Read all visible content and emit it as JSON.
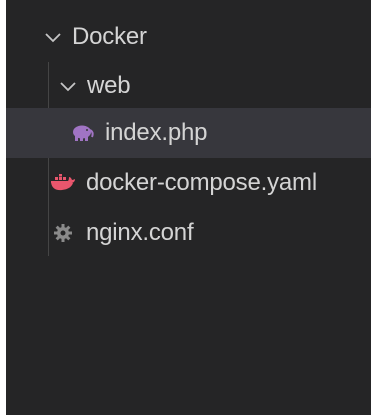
{
  "explorer": {
    "items": [
      {
        "label": "Docker",
        "type": "folder",
        "expanded": true,
        "icon": "chevron-down-icon"
      },
      {
        "label": "web",
        "type": "folder",
        "expanded": true,
        "icon": "chevron-down-icon"
      },
      {
        "label": "index.php",
        "type": "file",
        "selected": true,
        "icon": "php-elephant-icon",
        "icon_color": "#a074c4"
      },
      {
        "label": "docker-compose.yaml",
        "type": "file",
        "icon": "docker-whale-icon",
        "icon_color": "#e8566d"
      },
      {
        "label": "nginx.conf",
        "type": "file",
        "icon": "gear-icon",
        "icon_color": "#8a8a8a"
      }
    ]
  },
  "colors": {
    "background": "#252526",
    "selected_row": "#37373d",
    "text": "#d4d4d4",
    "indent_guide": "#454545"
  }
}
